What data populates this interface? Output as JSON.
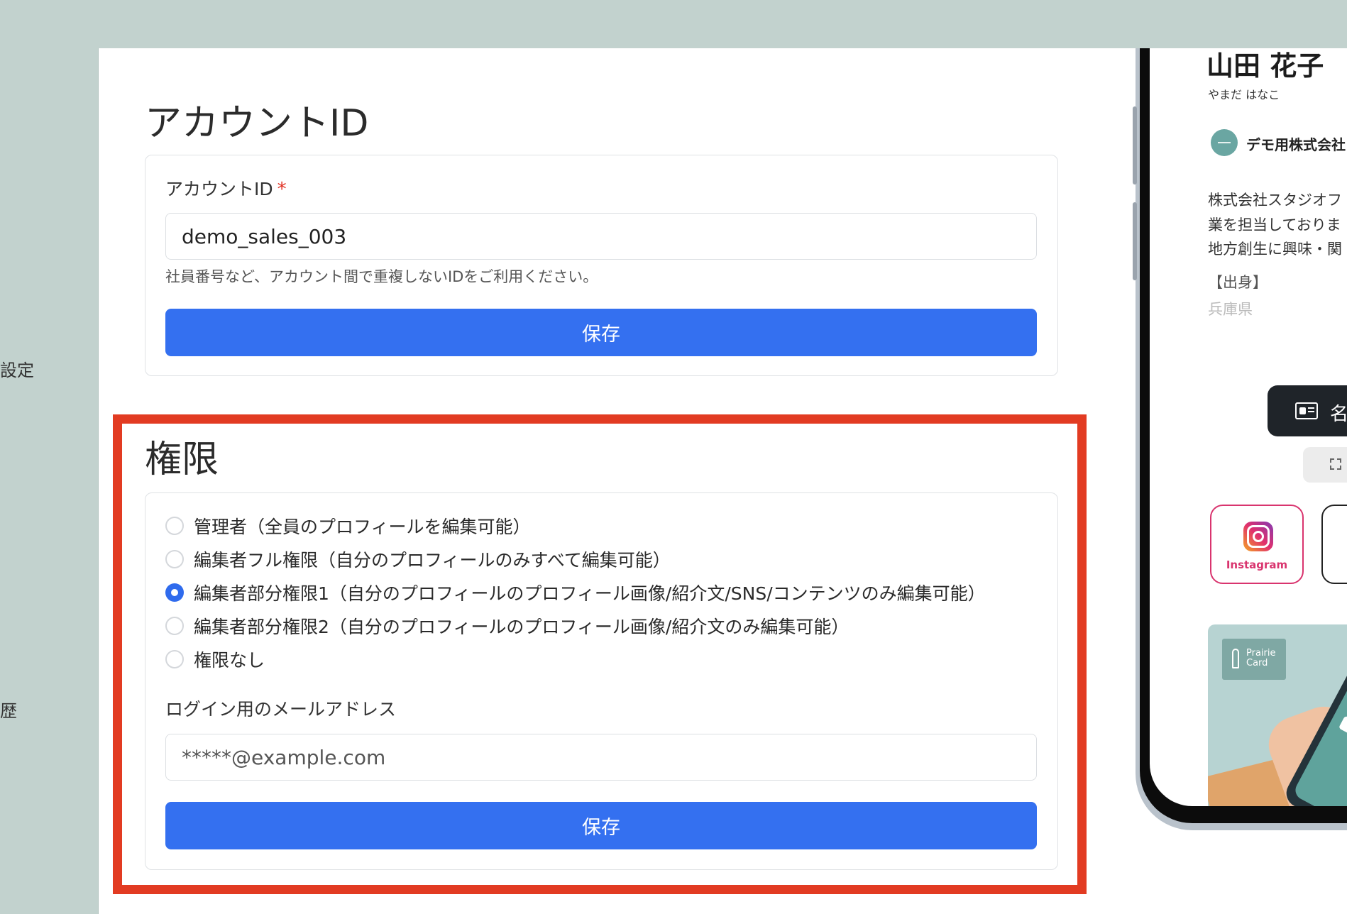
{
  "sidebar": {
    "items": [
      {
        "label": "設定"
      },
      {
        "label": "歴"
      }
    ]
  },
  "account_section": {
    "title": "アカウントID",
    "field_label": "アカウントID",
    "required_mark": "*",
    "input_value": "demo_sales_003",
    "help_text": "社員番号など、アカウント間で重複しないIDをご利用ください。",
    "save_label": "保存"
  },
  "permission_section": {
    "title": "権限",
    "options": [
      {
        "label": "管理者（全員のプロフィールを編集可能）",
        "checked": false
      },
      {
        "label": "編集者フル権限（自分のプロフィールのみすべて編集可能）",
        "checked": false
      },
      {
        "label": "編集者部分権限1（自分のプロフィールのプロフィール画像/紹介文/SNS/コンテンツのみ編集可能）",
        "checked": true
      },
      {
        "label": "編集者部分権限2（自分のプロフィールのプロフィール画像/紹介文のみ編集可能）",
        "checked": false
      },
      {
        "label": "権限なし",
        "checked": false
      }
    ],
    "email_label": "ログイン用のメールアドレス",
    "email_placeholder": "*****@example.com",
    "save_label": "保存"
  },
  "phone_preview": {
    "name": "山田 花子",
    "kana": "やまだ はなこ",
    "company": "デモ用株式会社",
    "bio_lines": [
      "株式会社スタジオフ",
      "業を担当しておりま",
      "地方創生に興味・関"
    ],
    "origin_label": "【出身】",
    "origin_value": "兵庫県",
    "card_button_label": "名",
    "instagram_label": "Instagram",
    "banner_logo_line1": "Prairie",
    "banner_logo_line2": "Card"
  },
  "colors": {
    "primary": "#3470f0",
    "highlight": "#e23b22",
    "required": "#e03124",
    "sidebar_bg": "#c2d2ce"
  }
}
